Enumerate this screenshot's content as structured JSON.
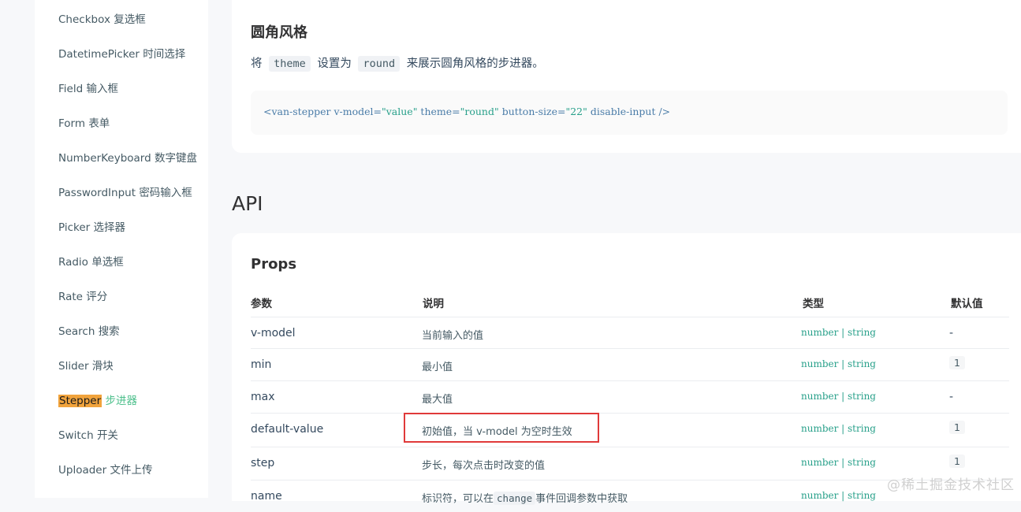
{
  "sidebar": {
    "items": [
      {
        "en": "Checkbox",
        "cn": "复选框"
      },
      {
        "en": "DatetimePicker",
        "cn": "时间选择"
      },
      {
        "en": "Field",
        "cn": "输入框"
      },
      {
        "en": "Form",
        "cn": "表单"
      },
      {
        "en": "NumberKeyboard",
        "cn": "数字键盘"
      },
      {
        "en": "PasswordInput",
        "cn": "密码输入框"
      },
      {
        "en": "Picker",
        "cn": "选择器"
      },
      {
        "en": "Radio",
        "cn": "单选框"
      },
      {
        "en": "Rate",
        "cn": "评分"
      },
      {
        "en": "Search",
        "cn": "搜索"
      },
      {
        "en": "Slider",
        "cn": "滑块"
      },
      {
        "en": "Stepper",
        "cn": "步进器"
      },
      {
        "en": "Switch",
        "cn": "开关"
      },
      {
        "en": "Uploader",
        "cn": "文件上传"
      }
    ]
  },
  "round_section": {
    "title": "圆角风格",
    "desc_prefix": "将",
    "desc_code1": "theme",
    "desc_mid": "设置为",
    "desc_code2": "round",
    "desc_suffix": "来展示圆角风格的步进器。",
    "code": {
      "p1": "<van-stepper v-model=",
      "s1": "\"value\"",
      "p2": " theme=",
      "s2": "\"round\"",
      "p3": " button-size=",
      "s3": "\"22\"",
      "p4": " disable-input />"
    }
  },
  "api": {
    "title": "API",
    "props_title": "Props",
    "headers": {
      "param": "参数",
      "desc": "说明",
      "type": "类型",
      "default": "默认值"
    },
    "rows": [
      {
        "param": "v-model",
        "desc": "当前输入的值",
        "type": "number | string",
        "default": "-"
      },
      {
        "param": "min",
        "desc": "最小值",
        "type": "number | string",
        "default": "1"
      },
      {
        "param": "max",
        "desc": "最大值",
        "type": "number | string",
        "default": "-"
      },
      {
        "param": "default-value",
        "desc": "初始值，当 v-model 为空时生效",
        "type": "number | string",
        "default": "1"
      },
      {
        "param": "step",
        "desc": "步长，每次点击时改变的值",
        "type": "number | string",
        "default": "1"
      },
      {
        "param": "name",
        "desc_pre": "标识符，可以在",
        "desc_code": "change",
        "desc_post": "事件回调参数中获取",
        "type": "number | string",
        "default": ""
      }
    ]
  },
  "watermark": "@稀土掘金技术社区"
}
